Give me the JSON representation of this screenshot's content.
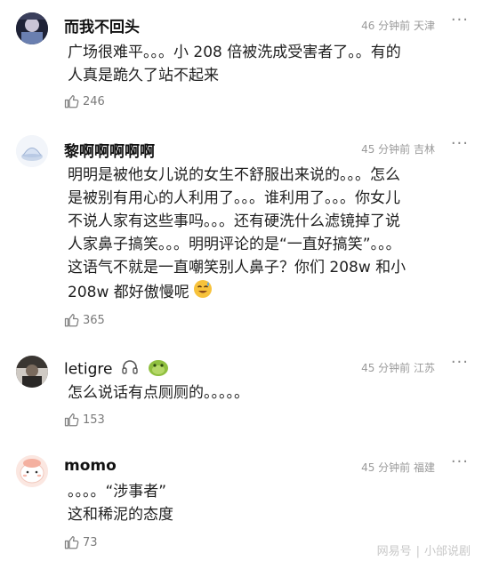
{
  "comments": [
    {
      "author": "而我不回头",
      "time": "46 分钟前",
      "location": "天津",
      "text": "广场很难平。。。小 208 倍被洗成受害者了。。有的\n人真是跪久了站不起来",
      "likes": "246"
    },
    {
      "author": "黎啊啊啊啊啊",
      "time": "45 分钟前",
      "location": "吉林",
      "text": "明明是被他女儿说的女生不舒服出来说的。。。怎么\n是被别有用心的人利用了。。。谁利用了。。。你女儿\n不说人家有这些事吗。。。还有硬洗什么滤镜掉了说\n人家鼻子搞笑。。。明明评论的是“一直好搞笑”。。。\n这语气不就是一直嘲笑别人鼻子？你们 208w 和小\n208w 都好傲慢呢",
      "likes": "365"
    },
    {
      "author": "letigre",
      "time": "45 分钟前",
      "location": "江苏",
      "text": "怎么说话有点厕厕的。。。。。",
      "likes": "153"
    },
    {
      "author": "momo",
      "time": "45 分钟前",
      "location": "福建",
      "text": "。。。。“涉事者”\n这和稀泥的态度",
      "likes": "73"
    }
  ],
  "more_icon": "more-dots-icon",
  "like_icon": "thumb-up-icon",
  "watermark": {
    "brand": "网易号",
    "account": "小邰说剧"
  }
}
